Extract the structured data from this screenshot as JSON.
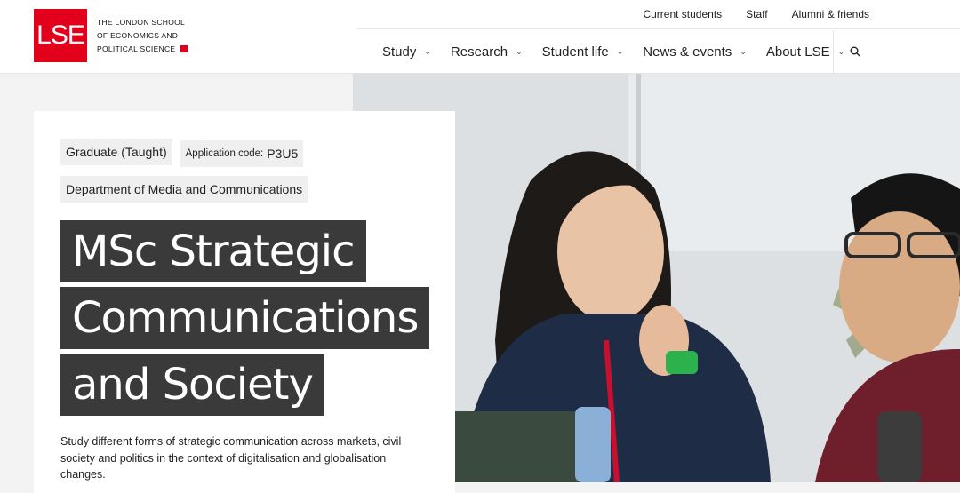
{
  "logo": {
    "mark": "LSE",
    "line1": "THE LONDON SCHOOL",
    "line2": "OF ECONOMICS AND",
    "line3": "POLITICAL SCIENCE"
  },
  "util_nav": [
    "Current students",
    "Staff",
    "Alumni & friends"
  ],
  "main_nav": [
    "Study",
    "Research",
    "Student life",
    "News & events",
    "About LSE"
  ],
  "tags": {
    "level": "Graduate (Taught)",
    "app_code_label": "Application code:",
    "app_code": "P3U5",
    "department": "Department of Media and Communications"
  },
  "title_lines": [
    "MSc Strategic",
    "Communications",
    "and Society"
  ],
  "description": "Study different forms of strategic communication across markets, civil society and politics in the context of digitalisation and globalisation changes.",
  "colors": {
    "brand_red": "#e3001b",
    "title_bg": "#3a3a3a"
  }
}
